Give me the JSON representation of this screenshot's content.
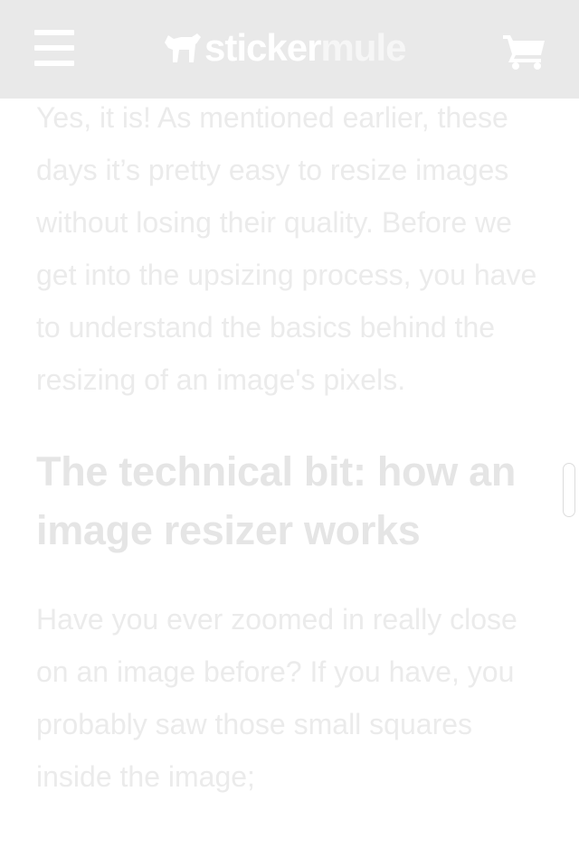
{
  "header": {
    "menu_icon": "hamburger-menu-icon",
    "logo": {
      "part1": "sticker",
      "part2": "mule",
      "mark_icon": "mule-logo-icon"
    },
    "cart_icon": "shopping-cart-icon"
  },
  "article": {
    "paragraph1": "Yes, it is! As mentioned earlier, these days it’s pretty easy to resize images without losing their quality. Before we get into the upsizing process, you have to understand the basics behind the resizing of an image's pixels.",
    "heading": "The technical bit: how an image resizer works",
    "paragraph2": "Have you ever zoomed in really close on an image before? If you have, you probably saw those small squares inside the image;"
  },
  "colors": {
    "header_bg": "#e9e9e9",
    "text": "#ebebeb",
    "heading": "#e5e5e5"
  }
}
